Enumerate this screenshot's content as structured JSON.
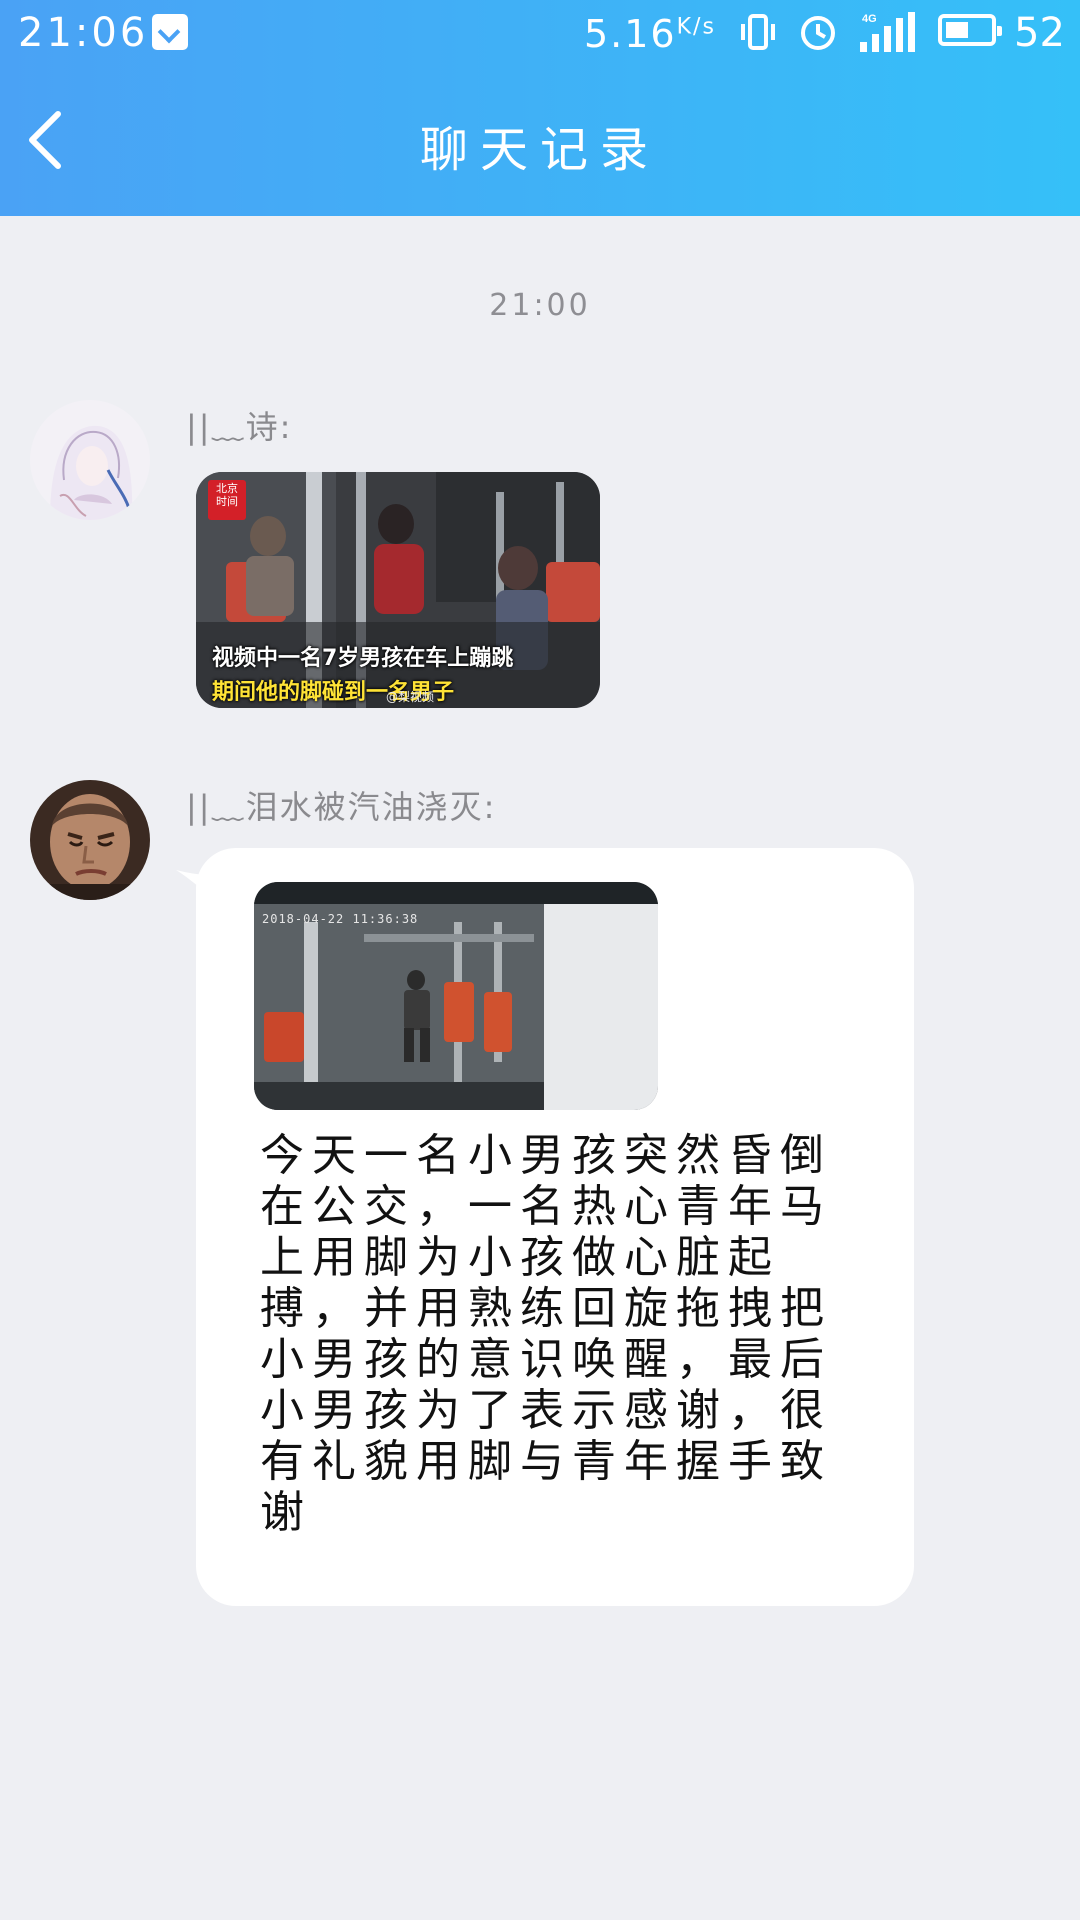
{
  "status_bar": {
    "time": "21:06",
    "net_speed": "5.16",
    "net_speed_unit": "K/s",
    "network_type": "4G",
    "battery_level": 52,
    "battery_text": "52"
  },
  "header": {
    "title": "聊天记录",
    "back_icon": "chevron-left-icon",
    "color_start": "#4aa2f5",
    "color_end": "#35c0f8"
  },
  "chat": {
    "timestamp": "21:00",
    "messages": [
      {
        "sender": "||﹏诗:",
        "avatar": "illustrated-girl-avatar",
        "type": "image",
        "image": {
          "badge_line1": "北京",
          "badge_line2": "时间",
          "caption_line1": "视频中一名7岁男孩在车上蹦跳",
          "caption_line2": "期间他的脚碰到一名男子",
          "watermark": "@梨视频"
        }
      },
      {
        "sender": "||﹏泪水被汽油浇灭:",
        "avatar": "man-photo-avatar",
        "type": "image+text",
        "image": {
          "timestamp": "2018-04-22 11:36:38"
        },
        "text": "今天一名小男孩突然昏倒在公交，一名热心青年马上用脚为小孩做心脏起搏，并用熟练回旋拖拽把小男孩的意识唤醒，最后小男孩为了表示感谢，很有礼貌用脚与青年握手致谢"
      }
    ]
  }
}
